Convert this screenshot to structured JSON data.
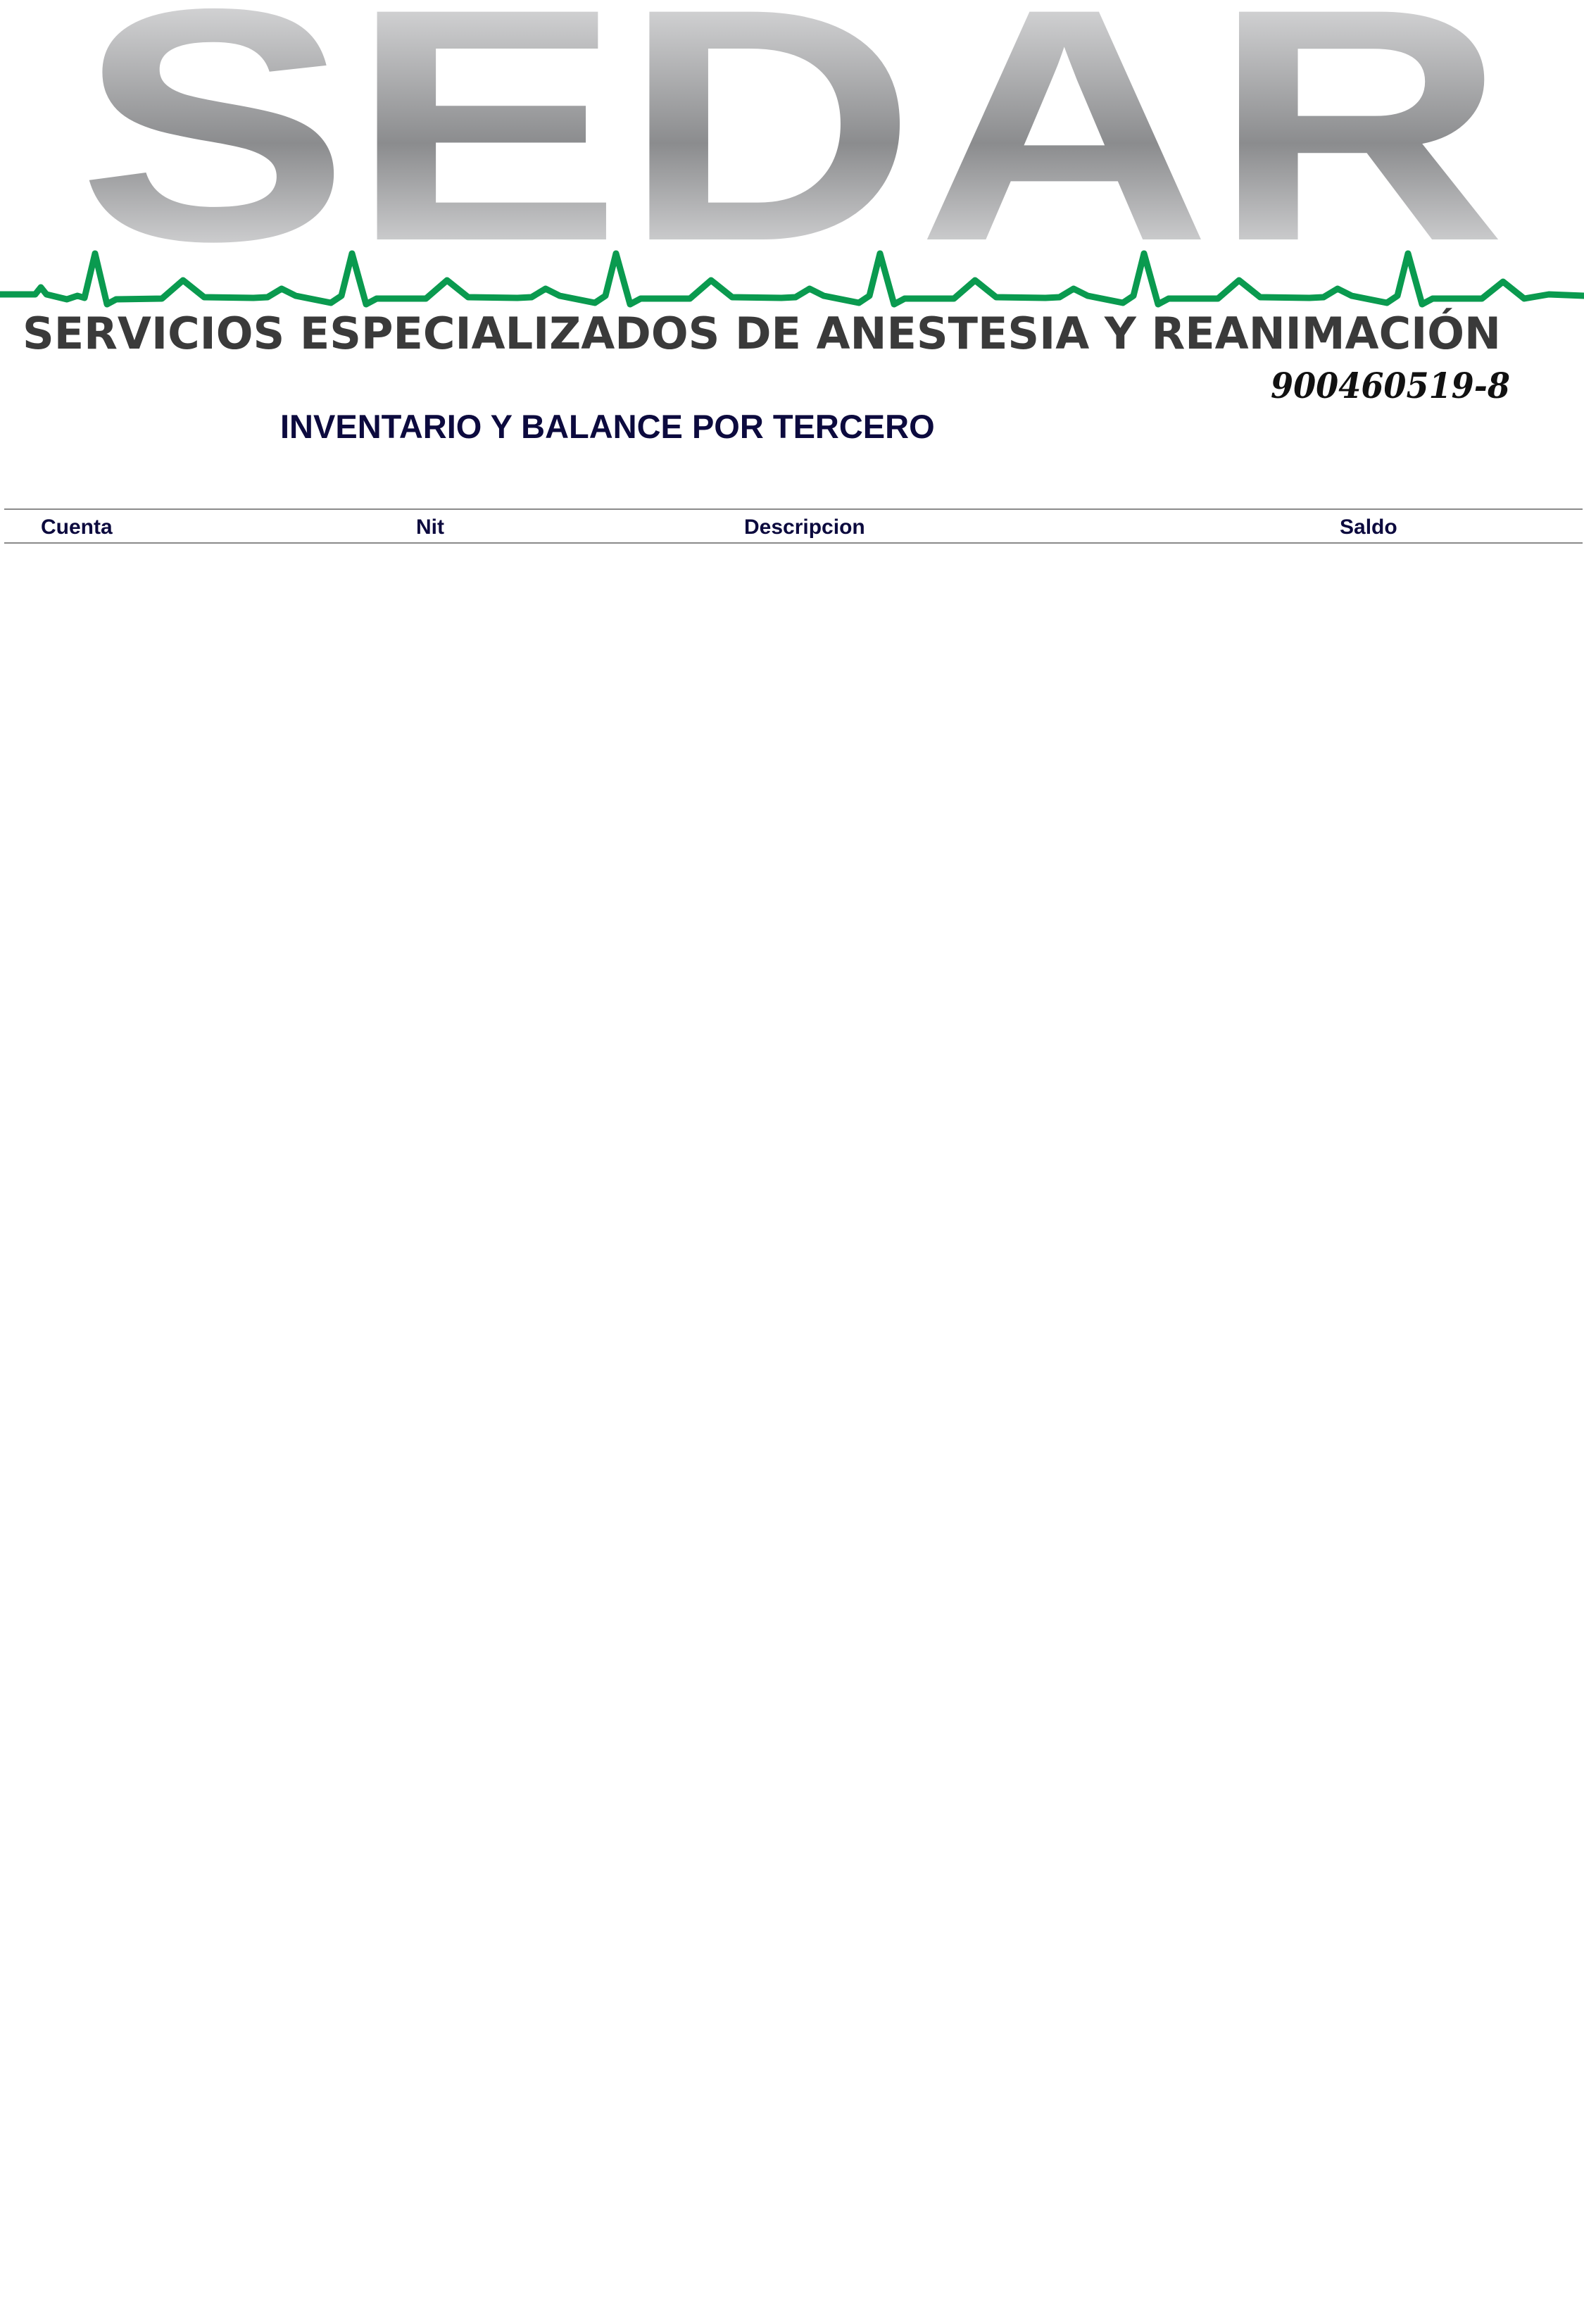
{
  "logo": {
    "wordmark": "SEDAR",
    "tagline": "SERVICIOS ESPECIALIZADOS DE ANESTESIA Y REANIMACIÓN",
    "nit": "900460519-8",
    "colors": {
      "wordmark_light": "#f2f2f3",
      "wordmark_dark": "#8b8c8e",
      "heartbeat": "#0a9a4f",
      "tagline": "#3a3a3a"
    }
  },
  "report": {
    "title": "INVENTARIO Y BALANCE POR TERCERO"
  },
  "table": {
    "columns": [
      "Cuenta",
      "Nit",
      "Descripcion",
      "Saldo"
    ],
    "rows": []
  },
  "colors": {
    "text_navy": "#0c0a3e",
    "rule": "#8a8a8a"
  }
}
